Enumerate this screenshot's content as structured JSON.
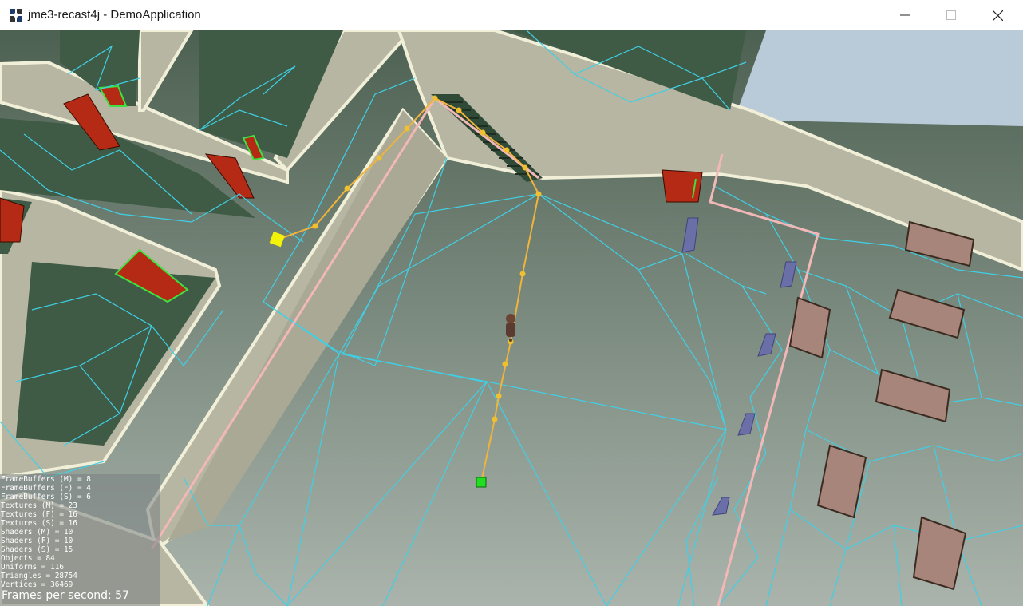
{
  "window": {
    "title": "jme3-recast4j - DemoApplication",
    "icon": "jmonkey-app-icon",
    "controls": {
      "minimize": "minimize-icon",
      "maximize": "maximize-icon",
      "close": "close-icon"
    }
  },
  "scene": {
    "description_icons": [
      "navmesh-wireframe",
      "path-waypoints",
      "character",
      "start-marker",
      "end-marker"
    ],
    "colors": {
      "navmesh": "#3fd0e6",
      "path": "#f0b43a",
      "start_marker": "#f5f20a",
      "end_marker": "#22dd22",
      "floor": "#7e8f80",
      "wall": "#b8b8a4",
      "door": "#b52a14",
      "railing": "#f2b8b8",
      "sky": "#b9cad8"
    }
  },
  "stats": {
    "lines": [
      "FrameBuffers (M) = 8",
      "FrameBuffers (F) = 4",
      "FrameBuffers (S) = 6",
      "Textures (M) = 23",
      "Textures (F) = 16",
      "Textures (S) = 16",
      "Shaders (M) = 10",
      "Shaders (F) = 10",
      "Shaders (S) = 15",
      "Objects = 84",
      "Uniforms = 116",
      "Triangles = 28754",
      "Vertices = 36469"
    ],
    "fps": "Frames per second: 57"
  }
}
